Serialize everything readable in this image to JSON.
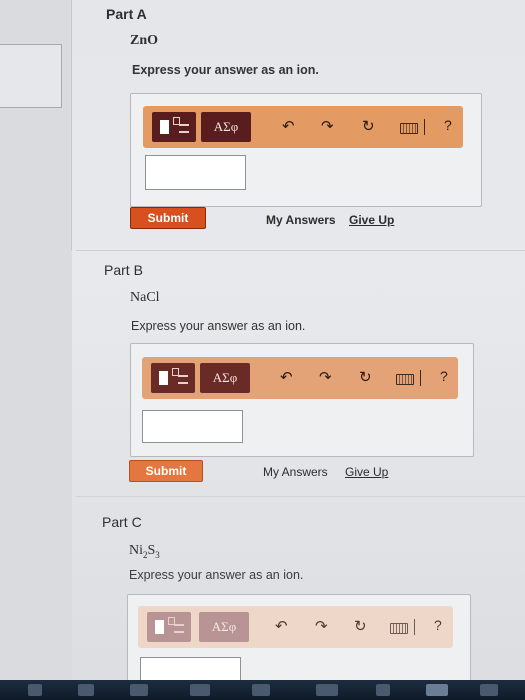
{
  "parts": [
    {
      "title": "Part A",
      "formula": "ZnO",
      "instruction": "Express your answer as an ion.",
      "greek_label": "ΑΣφ",
      "help_label": "?",
      "submit_label": "Submit",
      "my_answers_label": "My Answers",
      "give_up_label": "Give Up"
    },
    {
      "title": "Part B",
      "formula": "NaCl",
      "instruction": "Express your answer as an ion.",
      "greek_label": "ΑΣφ",
      "help_label": "?",
      "submit_label": "Submit",
      "my_answers_label": "My Answers",
      "give_up_label": "Give Up"
    },
    {
      "title": "Part C",
      "formula_base": "Ni",
      "formula_sub1": "2",
      "formula_mid": "S",
      "formula_sub2": "3",
      "instruction": "Express your answer as an ion.",
      "greek_label": "ΑΣφ",
      "help_label": "?"
    }
  ],
  "colors": {
    "toolbar_bg": "#e39a63",
    "button_dark": "#5a1d1d",
    "submit_bg": "#e2561e"
  },
  "icons": [
    "templates-icon",
    "greek-letters-icon",
    "undo-icon",
    "redo-icon",
    "reset-icon",
    "keyboard-icon",
    "help-icon"
  ]
}
